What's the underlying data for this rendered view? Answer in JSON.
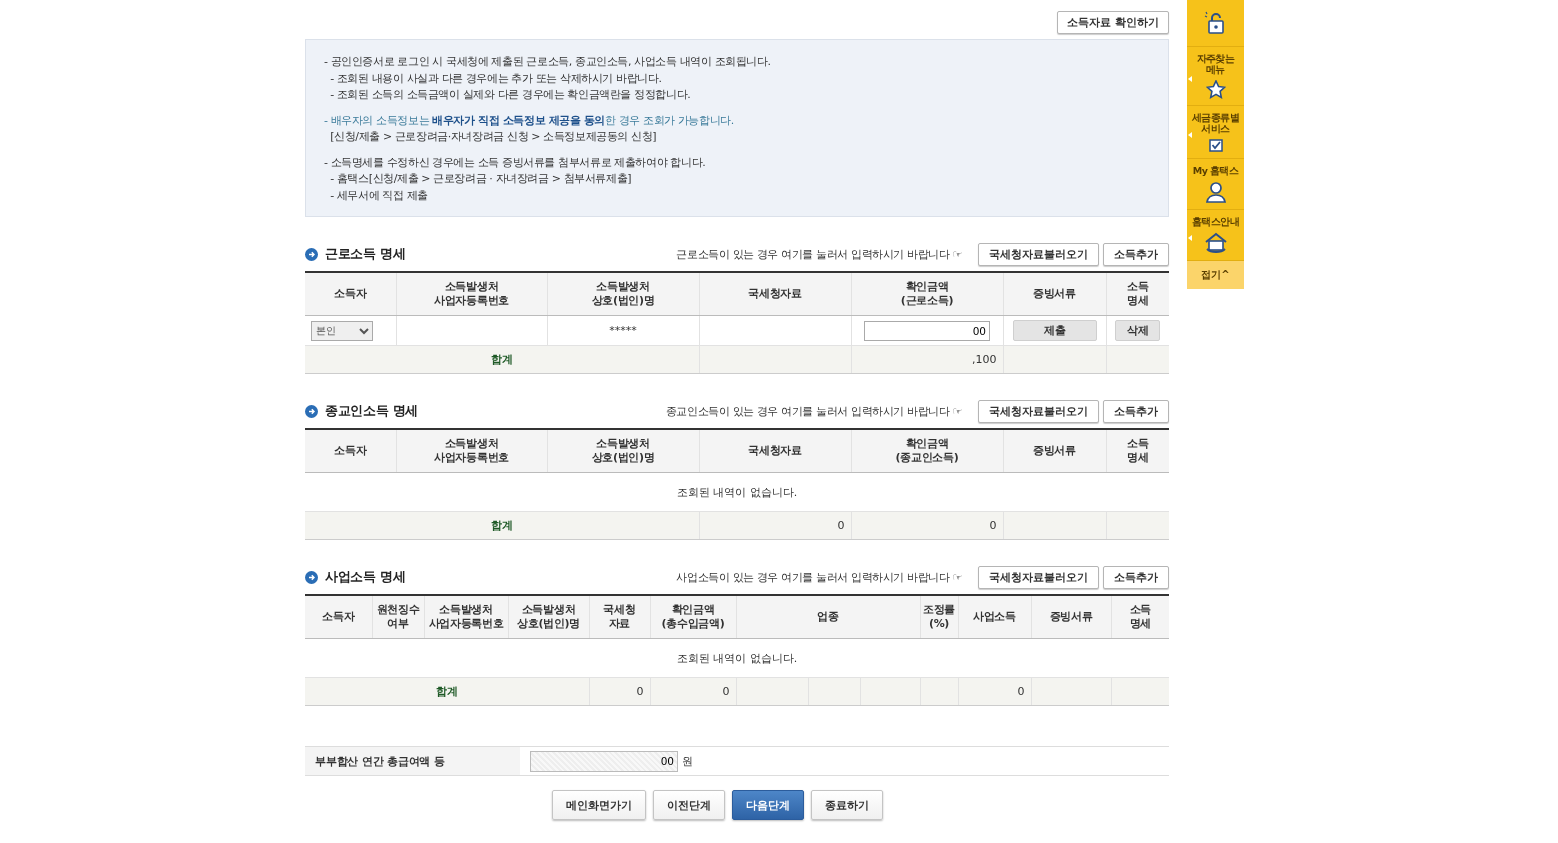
{
  "top_button": "소득자료 확인하기",
  "notice": [
    {
      "lines": [
        {
          "text": "- 공인인증서로 로그인 시 국세청에 제출된 근로소득, 종교인소득, 사업소득 내역이 조회됩니다.",
          "highlight": false
        },
        {
          "text": "  - 조회된 내용이 사실과 다른 경우에는 추가 또는 삭제하시기 바랍니다.",
          "highlight": false
        },
        {
          "text": "  - 조회된 소득의 소득금액이 실제와 다른 경우에는 확인금액란을 정정합니다.",
          "highlight": false
        }
      ]
    },
    {
      "lines": [
        {
          "text": "- 배우자의 소득정보는 **배우자가 직접 소득정보 제공을 동의**한 경우 조회가 가능합니다.",
          "highlight": true
        },
        {
          "text": "  [신청/제출 > 근로장려금·자녀장려금 신청 > 소득정보제공동의 신청]",
          "highlight": false
        }
      ]
    },
    {
      "lines": [
        {
          "text": "- 소득명세를 수정하신 경우에는 소득 증빙서류를 첨부서류로 제출하여야 합니다.",
          "highlight": false
        },
        {
          "text": "  - 홈택스[신청/제출 > 근로장려금 · 자녀장려금 > 첨부서류제출]",
          "highlight": false
        },
        {
          "text": "  - 세무서에 직접 제출",
          "highlight": false
        }
      ]
    }
  ],
  "sections": [
    {
      "title": "근로소득 명세",
      "hint": "근로소득이 있는 경우 여기를 눌러서 입력하시기 바랍니다 ☞",
      "buttons": [
        "국세청자료불러오기",
        "소득추가"
      ],
      "columns": [
        {
          "label": "소득자"
        },
        {
          "label": "소득발생처\n사업자등록번호"
        },
        {
          "label": "소득발생처\n상호(법인)명"
        },
        {
          "label": "국세청자료"
        },
        {
          "label": "확인금액\n(근로소득)"
        },
        {
          "label": "증빙서류"
        },
        {
          "label": "소득\n명세"
        }
      ],
      "rows": [
        [
          {
            "kind": "select",
            "value": "본인"
          },
          {
            "kind": "blank"
          },
          {
            "kind": "text",
            "text": "*****"
          },
          {
            "kind": "blank"
          },
          {
            "kind": "input",
            "value": "00"
          },
          {
            "kind": "button",
            "text": "제출"
          },
          {
            "kind": "small-button",
            "text": "삭제"
          }
        ]
      ],
      "total": [
        {
          "kind": "label",
          "text": "합계"
        },
        {
          "kind": "blank"
        },
        {
          "kind": "amount",
          "text": ",100"
        },
        {
          "kind": "blank"
        },
        {
          "kind": "blank"
        }
      ]
    },
    {
      "title": "종교인소득 명세",
      "hint": "종교인소득이 있는 경우 여기를 눌러서 입력하시기 바랍니다 ☞",
      "buttons": [
        "국세청자료불러오기",
        "소득추가"
      ],
      "columns": [
        {
          "label": "소득자"
        },
        {
          "label": "소득발생처\n사업자등록번호"
        },
        {
          "label": "소득발생처\n상호(법인)명"
        },
        {
          "label": "국세청자료"
        },
        {
          "label": "확인금액\n(종교인소득)"
        },
        {
          "label": "증빙서류"
        },
        {
          "label": "소득\n명세"
        }
      ],
      "empty_message": "조회된 내역이 없습니다.",
      "total": [
        {
          "kind": "label",
          "text": "합계"
        },
        {
          "kind": "amount",
          "text": "0"
        },
        {
          "kind": "amount",
          "text": "0"
        },
        {
          "kind": "blank"
        },
        {
          "kind": "blank"
        }
      ]
    },
    {
      "title": "사업소득 명세",
      "hint": "사업소득이 있는 경우 여기를 눌러서 입력하시기 바랍니다 ☞",
      "buttons": [
        "국세청자료불러오기",
        "소득추가"
      ],
      "columns": [
        {
          "label": "소득자"
        },
        {
          "label": "원천징수\n여부"
        },
        {
          "label": "소득발생처\n사업자등록번호"
        },
        {
          "label": "소득발생처\n상호(법인)명"
        },
        {
          "label": "국세청\n자료"
        },
        {
          "label": "확인금액\n(총수입금액)"
        },
        {
          "label": "업종"
        },
        {
          "label": "조정률\n(%)"
        },
        {
          "label": "사업소득"
        },
        {
          "label": "증빙서류"
        },
        {
          "label": "소득\n명세"
        }
      ],
      "empty_message": "조회된 내역이 없습니다.",
      "total": [
        {
          "kind": "label",
          "text": "합계"
        },
        {
          "kind": "amount",
          "text": "0"
        },
        {
          "kind": "amount",
          "text": "0"
        },
        {
          "kind": "blank"
        },
        {
          "kind": "blank"
        },
        {
          "kind": "blank"
        },
        {
          "kind": "blank"
        },
        {
          "kind": "amount",
          "text": "0"
        },
        {
          "kind": "blank"
        },
        {
          "kind": "blank"
        }
      ]
    }
  ],
  "summary": {
    "label": "부부합산 연간 총급여액 등",
    "value": "00",
    "unit": "원"
  },
  "actions": [
    {
      "label": "메인화면가기",
      "primary": false
    },
    {
      "label": "이전단계",
      "primary": false
    },
    {
      "label": "다음단계",
      "primary": true
    },
    {
      "label": "종료하기",
      "primary": false
    }
  ],
  "sidebar": {
    "items": [
      {
        "submenu": false
      },
      {
        "label": "자주찾는\n메뉴",
        "submenu": true
      },
      {
        "label": "세금종류별\n서비스",
        "submenu": true
      },
      {
        "label": "My 홈택스",
        "submenu": false
      },
      {
        "label": "홈택스안내",
        "submenu": true
      }
    ],
    "collapse": "접기^"
  }
}
